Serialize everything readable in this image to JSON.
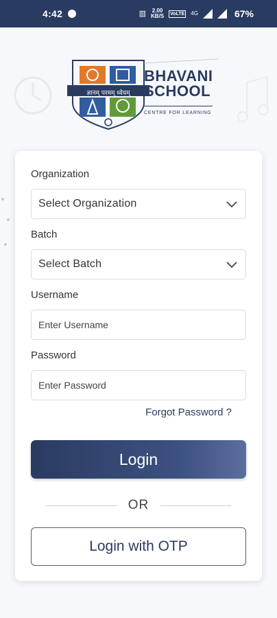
{
  "status_bar": {
    "time": "4:42",
    "network_speed": "2.00\nKB/S",
    "volte": "VoLTE",
    "signal_label": "4G",
    "battery": "67%"
  },
  "brand": {
    "name_line1": "BHAVANI",
    "name_line2": "SCHOOL",
    "tagline": "CENTRE FOR LEARNING",
    "logo_ribbon_text": "ज्ञानम् परमम् ध्येयम्"
  },
  "form": {
    "organization_label": "Organization",
    "organization_value": "Select Organization",
    "batch_label": "Batch",
    "batch_value": "Select Batch",
    "username_label": "Username",
    "username_placeholder": "Enter Username",
    "password_label": "Password",
    "password_placeholder": "Enter Password",
    "forgot_password": "Forgot Password ?",
    "login_button": "Login",
    "or_text": "OR",
    "otp_button": "Login with OTP"
  },
  "colors": {
    "primary": "#2a3b61",
    "logo_orange": "#e07a2a",
    "logo_blue": "#2f5d9e",
    "logo_green": "#5f9b3a"
  }
}
